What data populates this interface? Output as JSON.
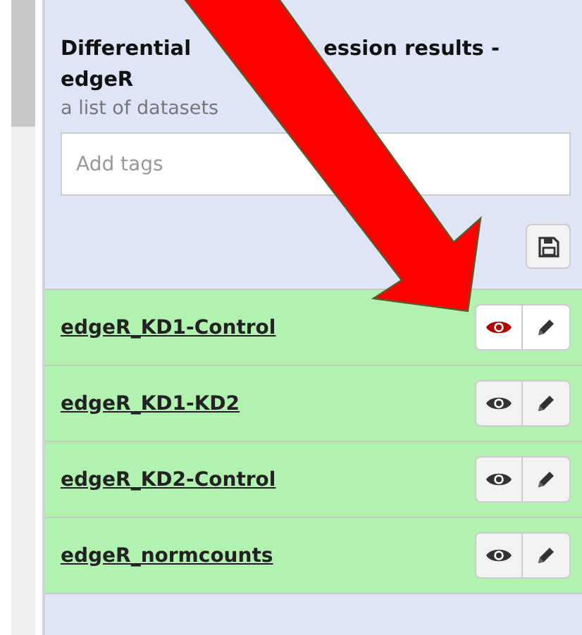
{
  "header": {
    "title_visible_parts": [
      "Differential",
      "ession results -",
      "edgeR"
    ],
    "subtitle": "a list of datasets",
    "tags_field": {
      "placeholder": "Add tags"
    }
  },
  "datasets": [
    {
      "name": "edgeR_KD1-Control",
      "viewing": true
    },
    {
      "name": "edgeR_KD1-KD2",
      "viewing": false
    },
    {
      "name": "edgeR_KD2-Control",
      "viewing": false
    },
    {
      "name": "edgeR_normcounts",
      "viewing": false
    }
  ]
}
